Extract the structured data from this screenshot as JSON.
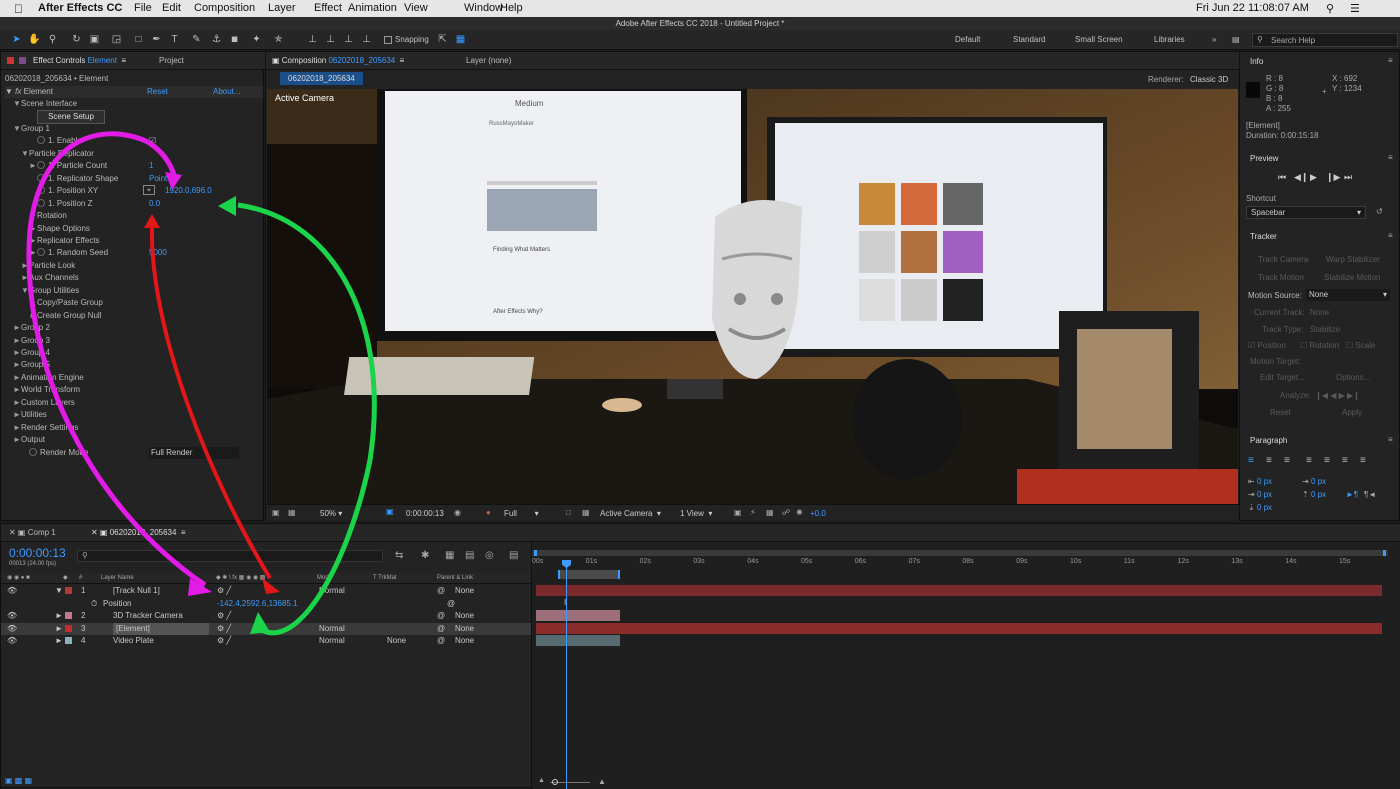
{
  "menubar": {
    "app": "After Effects CC",
    "items": [
      "File",
      "Edit",
      "Composition",
      "Layer",
      "Effect",
      "Animation",
      "View",
      "Window",
      "Help"
    ],
    "clock": "Fri Jun 22  11:08:07 AM"
  },
  "window_title": "Adobe After Effects CC 2018 - Untitled Project *",
  "toolbar": {
    "snapping": "Snapping",
    "workspaces": [
      "Default",
      "Standard",
      "Small Screen",
      "Libraries"
    ],
    "search_placeholder": "Search Help"
  },
  "effect_controls": {
    "tab": "Effect Controls",
    "tab_layer": "Element",
    "project_tab": "Project",
    "source": "06202018_205634 • Element",
    "effect_name": "Element",
    "reset": "Reset",
    "about": "About...",
    "rows": [
      {
        "indent": 1,
        "tri": "▼",
        "label": "Scene Interface",
        "value": ""
      },
      {
        "indent": 3,
        "tri": "",
        "label": "Scene Setup",
        "value": "",
        "button": true
      },
      {
        "indent": 1,
        "tri": "▼",
        "label": "Group 1",
        "value": ""
      },
      {
        "indent": 3,
        "tri": "",
        "sw": true,
        "label": "1. Enable",
        "value": "☑"
      },
      {
        "indent": 2,
        "tri": "▼",
        "label": "Particle Replicator",
        "value": ""
      },
      {
        "indent": 3,
        "tri": "►",
        "sw": true,
        "label": "1. Particle Count",
        "value": "1"
      },
      {
        "indent": 3,
        "tri": "",
        "sw": true,
        "label": "1. Replicator Shape",
        "value": "Point"
      },
      {
        "indent": 3,
        "tri": "",
        "sw": true,
        "label": "1. Position XY",
        "value": "1920.0,696.0",
        "crosshair": true
      },
      {
        "indent": 3,
        "tri": "",
        "sw": true,
        "label": "1. Position Z",
        "value": "0.0"
      },
      {
        "indent": 3,
        "tri": "►",
        "label": "Rotation",
        "value": ""
      },
      {
        "indent": 3,
        "tri": "►",
        "label": "Shape Options",
        "value": ""
      },
      {
        "indent": 3,
        "tri": "►",
        "label": "Replicator Effects",
        "value": ""
      },
      {
        "indent": 3,
        "tri": "►",
        "sw": true,
        "label": "1. Random Seed",
        "value": "5000"
      },
      {
        "indent": 2,
        "tri": "►",
        "label": "Particle Look",
        "value": ""
      },
      {
        "indent": 2,
        "tri": "►",
        "label": "Aux Channels",
        "value": ""
      },
      {
        "indent": 2,
        "tri": "▼",
        "label": "Group Utilities",
        "value": ""
      },
      {
        "indent": 3,
        "tri": "►",
        "label": "Copy/Paste Group",
        "value": ""
      },
      {
        "indent": 3,
        "tri": "►",
        "label": "Create Group Null",
        "value": ""
      },
      {
        "indent": 1,
        "tri": "►",
        "label": "Group 2",
        "value": ""
      },
      {
        "indent": 1,
        "tri": "►",
        "label": "Group 3",
        "value": ""
      },
      {
        "indent": 1,
        "tri": "►",
        "label": "Group 4",
        "value": ""
      },
      {
        "indent": 1,
        "tri": "►",
        "label": "Group 5",
        "value": ""
      },
      {
        "indent": 1,
        "tri": "►",
        "label": "Animation Engine",
        "value": ""
      },
      {
        "indent": 1,
        "tri": "►",
        "label": "World Transform",
        "value": ""
      },
      {
        "indent": 1,
        "tri": "►",
        "label": "Custom Layers",
        "value": ""
      },
      {
        "indent": 1,
        "tri": "►",
        "label": "Utilities",
        "value": ""
      },
      {
        "indent": 1,
        "tri": "►",
        "label": "Render Settings",
        "value": ""
      },
      {
        "indent": 1,
        "tri": "►",
        "label": "Output",
        "value": ""
      },
      {
        "indent": 2,
        "tri": "",
        "sw": true,
        "label": "Render Mode",
        "value": "Full Render",
        "dropdown": true
      }
    ]
  },
  "composition": {
    "tab": "Composition",
    "tab_name": "06202018_205634",
    "layer_tab": "Layer (none)",
    "subtab": "06202018_205634",
    "renderer_label": "Renderer:",
    "renderer": "Classic 3D",
    "camera_label": "Active Camera",
    "footer": {
      "zoom": "50%",
      "time": "0:00:00:13",
      "resolution": "Full",
      "view": "Active Camera",
      "views": "1 View",
      "exposure": "+0.0"
    },
    "screen_left": {
      "site": "Medium",
      "author": "RussMayoMaker",
      "heading": "Finding What Matters",
      "post": "After Effects Why?"
    }
  },
  "info": {
    "title": "Info",
    "r": "R : 8",
    "g": "G : 8",
    "b": "B : 8",
    "a": "A : 255",
    "x": "X : 692",
    "y": "Y : 1234",
    "layer": "[Element]",
    "duration": "Duration: 0:00:15:18"
  },
  "preview": {
    "title": "Preview",
    "shortcut_label": "Shortcut",
    "shortcut": "Spacebar"
  },
  "tracker": {
    "title": "Tracker",
    "track_camera": "Track Camera",
    "warp_stabilizer": "Warp Stabilizer",
    "track_motion": "Track Motion",
    "stabilize_motion": "Stabilize Motion",
    "motion_source_label": "Motion Source:",
    "motion_source": "None",
    "current_track_label": "Current Track:",
    "current_track": "None",
    "track_type_label": "Track Type:",
    "track_type": "Stabilize",
    "position": "Position",
    "rotation": "Rotation",
    "scale": "Scale",
    "motion_target": "Motion Target:",
    "edit_target": "Edit Target...",
    "options": "Options...",
    "analyze": "Analyze:",
    "reset": "Reset",
    "apply": "Apply"
  },
  "paragraph": {
    "title": "Paragraph",
    "fields": [
      "0 px",
      "0 px",
      "0 px",
      "0 px",
      "0 px"
    ]
  },
  "timeline": {
    "tabs": [
      "Comp 1",
      "06202018_205634"
    ],
    "timecode": "0:00:00:13",
    "frames": "00013 (24.00 fps)",
    "headers": {
      "layer_name": "Layer Name",
      "mode": "Mode",
      "trkmat": "TrkMat",
      "parent": "Parent & Link"
    },
    "layers": [
      {
        "num": "1",
        "name": "[Track Null 1]",
        "color": "#b23a3a",
        "mode": "Normal",
        "trkmat": "",
        "parent": "None",
        "bar": "#7a2a2a"
      },
      {
        "num": "",
        "name": "Position",
        "color": "",
        "mode": "",
        "trkmat": "",
        "parent": "",
        "value": "-142.4,2592.6,13685.1",
        "sub": true
      },
      {
        "num": "2",
        "name": "3D Tracker Camera",
        "color": "#c07a8a",
        "mode": "",
        "trkmat": "",
        "parent": "None",
        "bar": "#9c6f7a"
      },
      {
        "num": "3",
        "name": "[Element]",
        "color": "#c03030",
        "mode": "Normal",
        "trkmat": "",
        "parent": "None",
        "bar": "#8a2c2c",
        "selected": true
      },
      {
        "num": "4",
        "name": "Video Plate",
        "color": "#8ab0b8",
        "mode": "Normal",
        "trkmat": "None",
        "parent": "None",
        "bar": "#556b70"
      }
    ],
    "ruler": [
      "00s",
      "01s",
      "02s",
      "03s",
      "04s",
      "05s",
      "06s",
      "07s",
      "08s",
      "09s",
      "10s",
      "11s",
      "12s",
      "13s",
      "14s",
      "15s"
    ]
  }
}
